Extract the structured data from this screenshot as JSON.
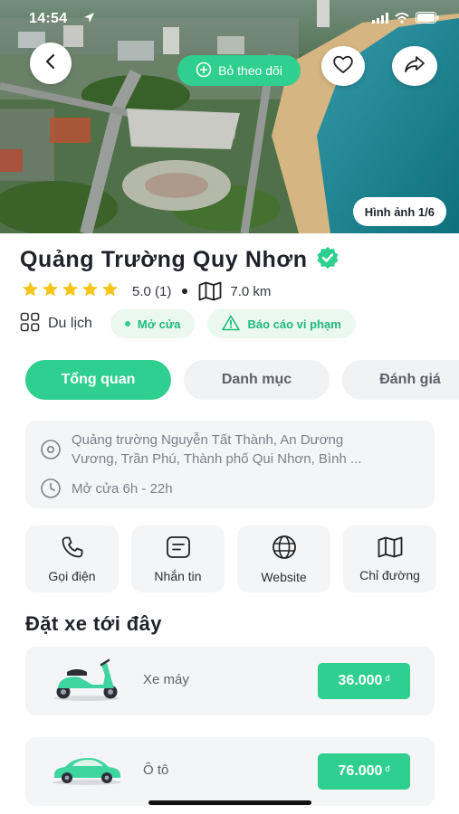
{
  "status_bar": {
    "time": "14:54"
  },
  "header": {
    "follow_label": "Bỏ theo dõi",
    "photo_counter": "Hình ảnh 1/6"
  },
  "place": {
    "name": "Quảng Trường Quy Nhơn",
    "rating": "5.0 (1)",
    "stars": 5,
    "distance": "7.0 km",
    "category": "Du lịch",
    "open_status": "Mở cửa",
    "report_label": "Báo cáo vi phạm"
  },
  "tabs": [
    {
      "label": "Tổng quan",
      "active": true
    },
    {
      "label": "Danh mục",
      "active": false
    },
    {
      "label": "Đánh giá",
      "active": false
    }
  ],
  "info": {
    "address_line1": "Quảng trường Nguyễn Tất Thành, An Dương",
    "address_line2": "Vương, Trần Phú, Thành phố Qui Nhơn, Bình ...",
    "hours": "Mở cửa 6h - 22h"
  },
  "actions": [
    {
      "label": "Gọi điện",
      "icon": "phone-icon"
    },
    {
      "label": "Nhắn tin",
      "icon": "message-icon"
    },
    {
      "label": "Website",
      "icon": "globe-icon"
    },
    {
      "label": "Chỉ đường",
      "icon": "map-icon"
    }
  ],
  "booking": {
    "title": "Đặt xe tới đây",
    "options": [
      {
        "label": "Xe máy",
        "price": "36.000",
        "currency": "đ",
        "icon": "scooter-icon"
      },
      {
        "label": "Ô tô",
        "price": "76.000",
        "currency": "đ",
        "icon": "car-icon"
      }
    ]
  },
  "colors": {
    "accent": "#2ecf8f",
    "accent_light": "#eaf8f0",
    "star": "#f5c518",
    "card_bg": "#f4f5f7"
  }
}
